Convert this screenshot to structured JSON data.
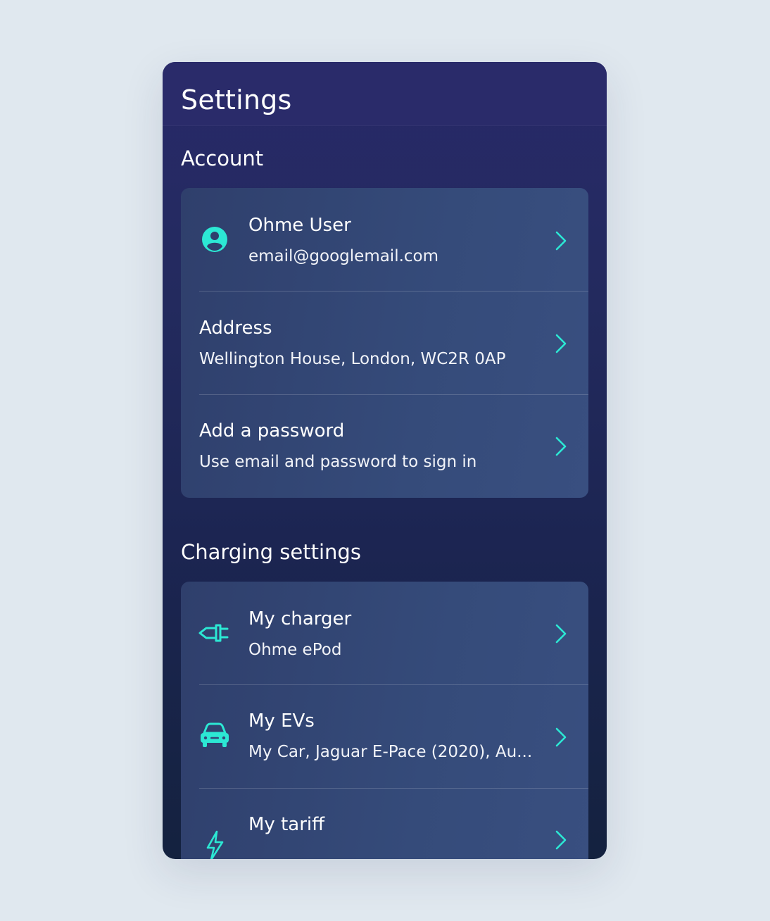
{
  "header": {
    "title": "Settings"
  },
  "sections": {
    "account": {
      "title": "Account",
      "rows": [
        {
          "title": "Ohme User",
          "subtitle": "email@googlemail.com",
          "icon": "user-icon"
        },
        {
          "title": "Address",
          "subtitle": "Wellington House, London, WC2R 0AP"
        },
        {
          "title": "Add a password",
          "subtitle": "Use email and password to sign in"
        }
      ]
    },
    "charging": {
      "title": "Charging settings",
      "rows": [
        {
          "title": "My charger",
          "subtitle": "Ohme ePod",
          "icon": "plug-icon"
        },
        {
          "title": "My EVs",
          "subtitle": "My Car, Jaguar E-Pace (2020), Au...",
          "icon": "car-icon"
        },
        {
          "title": "My tariff",
          "subtitle": "",
          "icon": "lightning-icon"
        }
      ]
    }
  },
  "colors": {
    "accent": "#2ce8d4",
    "background": "#e0e8ef",
    "header": "#2a2b6a",
    "card": "#354b7a"
  }
}
